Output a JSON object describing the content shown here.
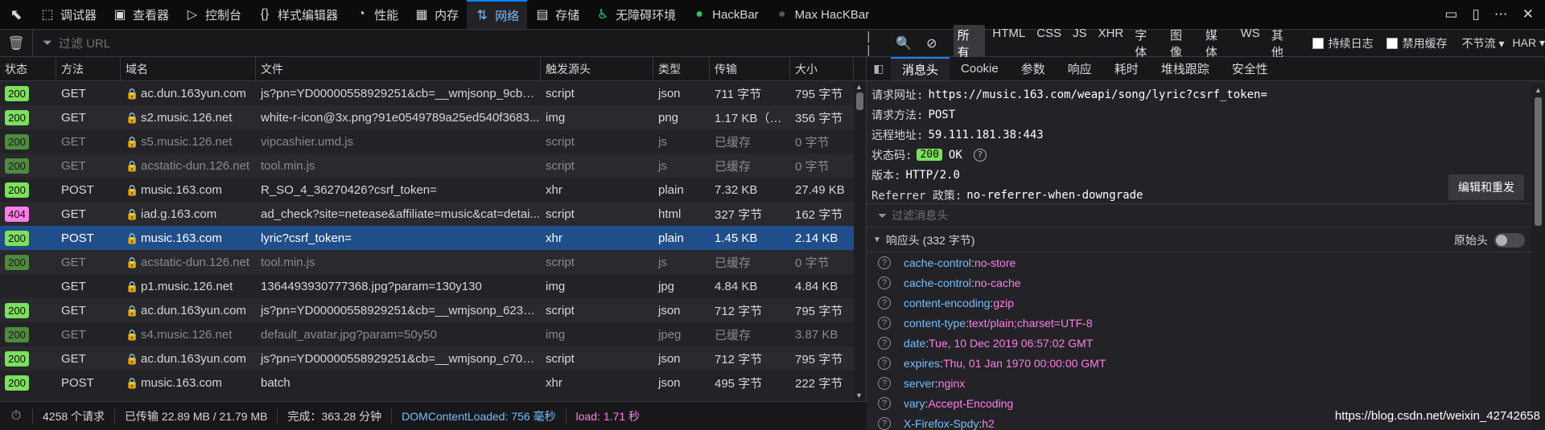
{
  "toolbox": {
    "tabs": [
      {
        "label": "调试器",
        "icon": "debugger-icon",
        "glyph": "⬚"
      },
      {
        "label": "查看器",
        "icon": "inspector-icon",
        "glyph": "▣"
      },
      {
        "label": "控制台",
        "icon": "console-icon",
        "glyph": "▷"
      },
      {
        "label": "样式编辑器",
        "icon": "style-editor-icon",
        "glyph": "{}"
      },
      {
        "label": "性能",
        "icon": "performance-icon",
        "glyph": "◔"
      },
      {
        "label": "内存",
        "icon": "memory-icon",
        "glyph": "▦"
      },
      {
        "label": "网络",
        "icon": "network-icon",
        "glyph": "⇅",
        "active": true
      },
      {
        "label": "存储",
        "icon": "storage-icon",
        "glyph": "▤"
      },
      {
        "label": "无障碍环境",
        "icon": "accessibility-icon",
        "glyph": "♿"
      },
      {
        "label": "HackBar",
        "icon": "hackbar-icon",
        "glyph": "●"
      },
      {
        "label": "Max HacKBar",
        "icon": "max-hackbar-icon",
        "glyph": "●"
      }
    ]
  },
  "toolbar": {
    "filter_placeholder": "过滤 URL",
    "type_filters": [
      "所有",
      "HTML",
      "CSS",
      "JS",
      "XHR",
      "字体",
      "图像",
      "媒体",
      "WS",
      "其他"
    ],
    "persist_log": "持续日志",
    "disable_cache": "禁用缓存",
    "throttling": "不节流 ▾",
    "har": "HAR ▾"
  },
  "list": {
    "columns": [
      "状态",
      "方法",
      "域名",
      "文件",
      "触发源头",
      "类型",
      "传输",
      "大小"
    ],
    "requests": [
      {
        "status": "200",
        "method": "GET",
        "domain": "ac.dun.163yun.com",
        "file": "js?pn=YD00000558929251&cb=__wmjsonp_9cb62...",
        "cause": "script",
        "type": "json",
        "transferred": "711 字节",
        "size": "795 字节",
        "dim": false
      },
      {
        "status": "200",
        "method": "GET",
        "domain": "s2.music.126.net",
        "file": "white-r-icon@3x.png?91e0549789a25ed540f3683...",
        "cause": "img",
        "type": "png",
        "transferred": "1.17 KB（已...",
        "size": "356 字节",
        "dim": false
      },
      {
        "status": "200",
        "method": "GET",
        "domain": "s5.music.126.net",
        "file": "vipcashier.umd.js",
        "cause": "script",
        "type": "js",
        "transferred": "已缓存",
        "size": "0 字节",
        "dim": true
      },
      {
        "status": "200",
        "method": "GET",
        "domain": "acstatic-dun.126.net",
        "file": "tool.min.js",
        "cause": "script",
        "type": "js",
        "transferred": "已缓存",
        "size": "0 字节",
        "dim": true
      },
      {
        "status": "200",
        "method": "POST",
        "domain": "music.163.com",
        "file": "R_SO_4_36270426?csrf_token=",
        "cause": "xhr",
        "type": "plain",
        "transferred": "7.32 KB",
        "size": "27.49 KB",
        "dim": false
      },
      {
        "status": "404",
        "method": "GET",
        "domain": "iad.g.163.com",
        "file": "ad_check?site=netease&affiliate=music&cat=detai...",
        "cause": "script",
        "type": "html",
        "transferred": "327 字节",
        "size": "162 字节",
        "dim": false
      },
      {
        "status": "200",
        "method": "POST",
        "domain": "music.163.com",
        "file": "lyric?csrf_token=",
        "cause": "xhr",
        "type": "plain",
        "transferred": "1.45 KB",
        "size": "2.14 KB",
        "dim": false,
        "selected": true
      },
      {
        "status": "200",
        "method": "GET",
        "domain": "acstatic-dun.126.net",
        "file": "tool.min.js",
        "cause": "script",
        "type": "js",
        "transferred": "已缓存",
        "size": "0 字节",
        "dim": true
      },
      {
        "status": "",
        "method": "GET",
        "domain": "p1.music.126.net",
        "file": "1364493930777368.jpg?param=130y130",
        "cause": "img",
        "type": "jpg",
        "transferred": "4.84 KB",
        "size": "4.84 KB",
        "dim": false
      },
      {
        "status": "200",
        "method": "GET",
        "domain": "ac.dun.163yun.com",
        "file": "js?pn=YD00000558929251&cb=__wmjsonp_62378...",
        "cause": "script",
        "type": "json",
        "transferred": "712 字节",
        "size": "795 字节",
        "dim": false
      },
      {
        "status": "200",
        "method": "GET",
        "domain": "s4.music.126.net",
        "file": "default_avatar.jpg?param=50y50",
        "cause": "img",
        "type": "jpeg",
        "transferred": "已缓存",
        "size": "3.87 KB",
        "dim": true
      },
      {
        "status": "200",
        "method": "GET",
        "domain": "ac.dun.163yun.com",
        "file": "js?pn=YD00000558929251&cb=__wmjsonp_c701ff...",
        "cause": "script",
        "type": "json",
        "transferred": "712 字节",
        "size": "795 字节",
        "dim": false
      },
      {
        "status": "200",
        "method": "POST",
        "domain": "music.163.com",
        "file": "batch",
        "cause": "xhr",
        "type": "json",
        "transferred": "495 字节",
        "size": "222 字节",
        "dim": false
      }
    ]
  },
  "statusbar": {
    "requests": "4258 个请求",
    "transferred": "已传输 22.89 MB / 21.79 MB",
    "finish": "完成：363.28 分钟",
    "dcl": "DOMContentLoaded: 756 毫秒",
    "load": "load: 1.71 秒"
  },
  "details": {
    "tabs": [
      "消息头",
      "Cookie",
      "参数",
      "响应",
      "耗时",
      "堆栈跟踪",
      "安全性"
    ],
    "request_url_label": "请求网址:",
    "request_url": "https://music.163.com/weapi/song/lyric?csrf_token=",
    "request_method_label": "请求方法:",
    "request_method": "POST",
    "remote_label": "远程地址:",
    "remote": "59.111.181.38:443",
    "status_label": "状态码:",
    "status_code": "200",
    "status_text": "OK",
    "version_label": "版本:",
    "version": "HTTP/2.0",
    "referrer_label": "Referrer 政策:",
    "referrer": "no-referrer-when-downgrade",
    "resend": "编辑和重发",
    "header_filter": "过滤消息头",
    "response_headers": "响应头 (332 字节)",
    "raw": "原始头",
    "headers": [
      {
        "name": "cache-control",
        "value": "no-store"
      },
      {
        "name": "cache-control",
        "value": "no-cache"
      },
      {
        "name": "content-encoding",
        "value": "gzip"
      },
      {
        "name": "content-type",
        "value": "text/plain;charset=UTF-8"
      },
      {
        "name": "date",
        "value": "Tue, 10 Dec 2019 06:57:02 GMT"
      },
      {
        "name": "expires",
        "value": "Thu, 01 Jan 1970 00:00:00 GMT"
      },
      {
        "name": "server",
        "value": "nginx"
      },
      {
        "name": "vary",
        "value": "Accept-Encoding"
      },
      {
        "name": "X-Firefox-Spdy",
        "value": "h2"
      }
    ]
  },
  "watermark": "https://blog.csdn.net/weixin_42742658"
}
